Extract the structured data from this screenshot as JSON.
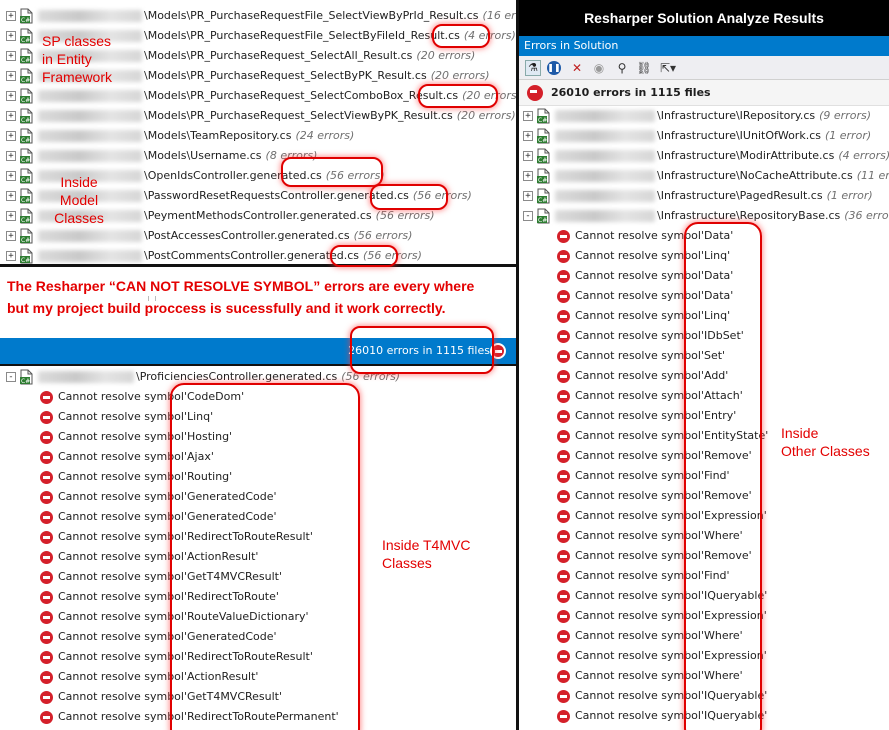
{
  "top_rows": [
    {
      "path": "\\Models\\PR_PurchaseRequestFile_SelectViewByPrId_Result.cs",
      "count": "(16 errors)"
    },
    {
      "path": "\\Models\\PR_PurchaseRequestFile_SelectByFileId_Result.cs",
      "count": "(4 errors)"
    },
    {
      "path": "\\Models\\PR_PurchaseRequest_SelectAll_Result.cs",
      "count": "(20 errors)"
    },
    {
      "path": "\\Models\\PR_PurchaseRequest_SelectByPK_Result.cs",
      "count": "(20 errors)"
    },
    {
      "path": "\\Models\\PR_PurchaseRequest_SelectComboBox_Result.cs",
      "count": "(20 errors)"
    },
    {
      "path": "\\Models\\PR_PurchaseRequest_SelectViewByPK_Result.cs",
      "count": "(20 errors)"
    },
    {
      "path": "\\Models\\TeamRepository.cs",
      "count": "(24 errors)"
    },
    {
      "path": "\\Models\\Username.cs",
      "count": "(8 errors)"
    },
    {
      "path": "\\OpenIdsController.generated.cs",
      "count": "(56 errors)"
    },
    {
      "path": "\\PasswordResetRequestsController.generated.cs",
      "count": "(56 errors)"
    },
    {
      "path": "\\PeymentMethodsController.generated.cs",
      "count": "(56 errors)"
    },
    {
      "path": "\\PostAccessesController.generated.cs",
      "count": "(56 errors)"
    },
    {
      "path": "\\PostCommentsController.generated.cs",
      "count": "(56 errors)"
    }
  ],
  "note": {
    "line1": "The Resharper “CAN NOT RESOLVE SYMBOL”  errors  are every where",
    "line2": "but my project build proccess is sucessfully and it work correctly."
  },
  "bottom_status": {
    "text": "26010 errors in 1115 files"
  },
  "bottom_file": {
    "path": "\\ProficienciesController.generated.cs",
    "count": "(56 errors)"
  },
  "bottom_errors": [
    "'CodeDom'",
    "'Linq'",
    "'Hosting'",
    "'Ajax'",
    "'Routing'",
    "'GeneratedCode'",
    "'GeneratedCode'",
    "'RedirectToRouteResult'",
    "'ActionResult'",
    "'GetT4MVCResult'",
    "'RedirectToRoute'",
    "'RouteValueDictionary'",
    "'GeneratedCode'",
    "'RedirectToRouteResult'",
    "'ActionResult'",
    "'GetT4MVCResult'",
    "'RedirectToRoutePermanent'"
  ],
  "error_prefix": "Cannot resolve symbol ",
  "right": {
    "title": "Resharper Solution Analyze Results",
    "tab_label": "Errors in Solution",
    "summary": "26010 errors in 1115 files",
    "files": [
      {
        "path": "\\Infrastructure\\IRepository.cs",
        "count": "(9 errors)"
      },
      {
        "path": "\\Infrastructure\\IUnitOfWork.cs",
        "count": "(1 error)"
      },
      {
        "path": "\\Infrastructure\\ModirAttribute.cs",
        "count": "(4 errors)"
      },
      {
        "path": "\\Infrastructure\\NoCacheAttribute.cs",
        "count": "(11 errors)"
      },
      {
        "path": "\\Infrastructure\\PagedResult.cs",
        "count": "(1 error)"
      },
      {
        "path": "\\Infrastructure\\RepositoryBase.cs",
        "count": "(36 errors)"
      }
    ],
    "errors": [
      "'Data'",
      "'Linq'",
      "'Data'",
      "'Data'",
      "'Linq'",
      "'IDbSet'",
      "'Set'",
      "'Add'",
      "'Attach'",
      "'Entry'",
      "'EntityState'",
      "'Remove'",
      "'Find'",
      "'Remove'",
      "'Expression'",
      "'Where'",
      "'Remove'",
      "'Find'",
      "'IQueryable'",
      "'Expression'",
      "'Where'",
      "'Expression'",
      "'Where'",
      "'IQueryable'",
      "'IQueryable'"
    ]
  },
  "annotations": {
    "sp": [
      "SP classes",
      "in Entity",
      "Framework"
    ],
    "model": [
      "Inside",
      "Model",
      "Classes"
    ],
    "t4mvc": [
      "Inside T4MVC",
      "Classes"
    ],
    "other": [
      "Inside",
      "Other Classes"
    ]
  },
  "colors": {
    "accent": "#007acc",
    "error": "#d4202a",
    "annotation": "#e30000"
  }
}
